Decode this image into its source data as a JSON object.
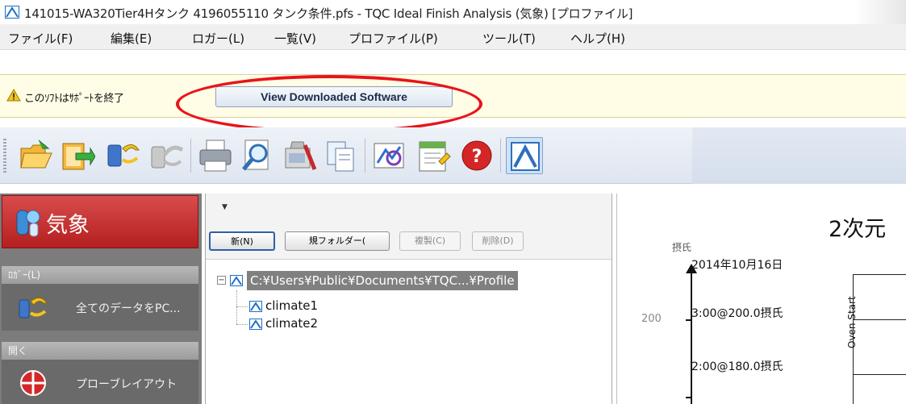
{
  "window": {
    "title": "141015-WA320Tier4Hタンク 4196055110 タンク条件.pfs - TQC Ideal Finish Analysis (気象) [プロファイル]"
  },
  "menu": {
    "items": [
      {
        "label": "ファイル(F)"
      },
      {
        "label": "編集(E)"
      },
      {
        "label": "ロガー(L)"
      },
      {
        "label": "一覧(V)"
      },
      {
        "label": "プロファイル(P)"
      },
      {
        "label": "ツール(T)"
      },
      {
        "label": "ヘルプ(H)"
      }
    ]
  },
  "notice": {
    "text": "このｿﾌﾄはｻﾎﾟｰﾄを終了",
    "button_label": "View Downloaded Software",
    "icon": "warning-icon"
  },
  "toolbar": {
    "buttons": [
      {
        "icon": "open-folder-icon"
      },
      {
        "icon": "export-icon"
      },
      {
        "icon": "download-data-icon"
      },
      {
        "icon": "upload-data-icon"
      },
      {
        "icon": "print-icon"
      },
      {
        "icon": "preview-icon"
      },
      {
        "icon": "tools-icon"
      },
      {
        "icon": "copy-icon"
      },
      {
        "icon": "analyze-icon"
      },
      {
        "icon": "notes-icon"
      },
      {
        "icon": "help-icon"
      },
      {
        "icon": "profile-curve-icon"
      }
    ]
  },
  "sidebar": {
    "header_label": "気象",
    "sections": [
      {
        "title": "ﾛｶﾞｰ(L)",
        "item_label": "全てのデータをPC..."
      },
      {
        "title": "開く",
        "item_label": "プローブレイアウト"
      }
    ]
  },
  "profiles_panel": {
    "buttons": {
      "new": "新(N)",
      "new_folder": "規フォルダー(",
      "copy": "複製(C)",
      "delete": "削除(D)"
    },
    "tree": {
      "root": "C:¥Users¥Public¥Documents¥TQC...¥Profile",
      "children": [
        "climate1",
        "climate2"
      ]
    }
  },
  "chart": {
    "title": "2次元",
    "unit": "摂氏",
    "date": "2014年10月16日",
    "y_tick_label": "200",
    "vertical_label": "Oven Start",
    "point_labels": [
      "3:00@200.0摂氏",
      "2:00@180.0摂氏"
    ]
  },
  "colors": {
    "notice_background": "#fffde6",
    "annotation_ellipse": "#e8141b",
    "sidebar_header": "#c42d2d",
    "tree_selection": "#808080"
  }
}
